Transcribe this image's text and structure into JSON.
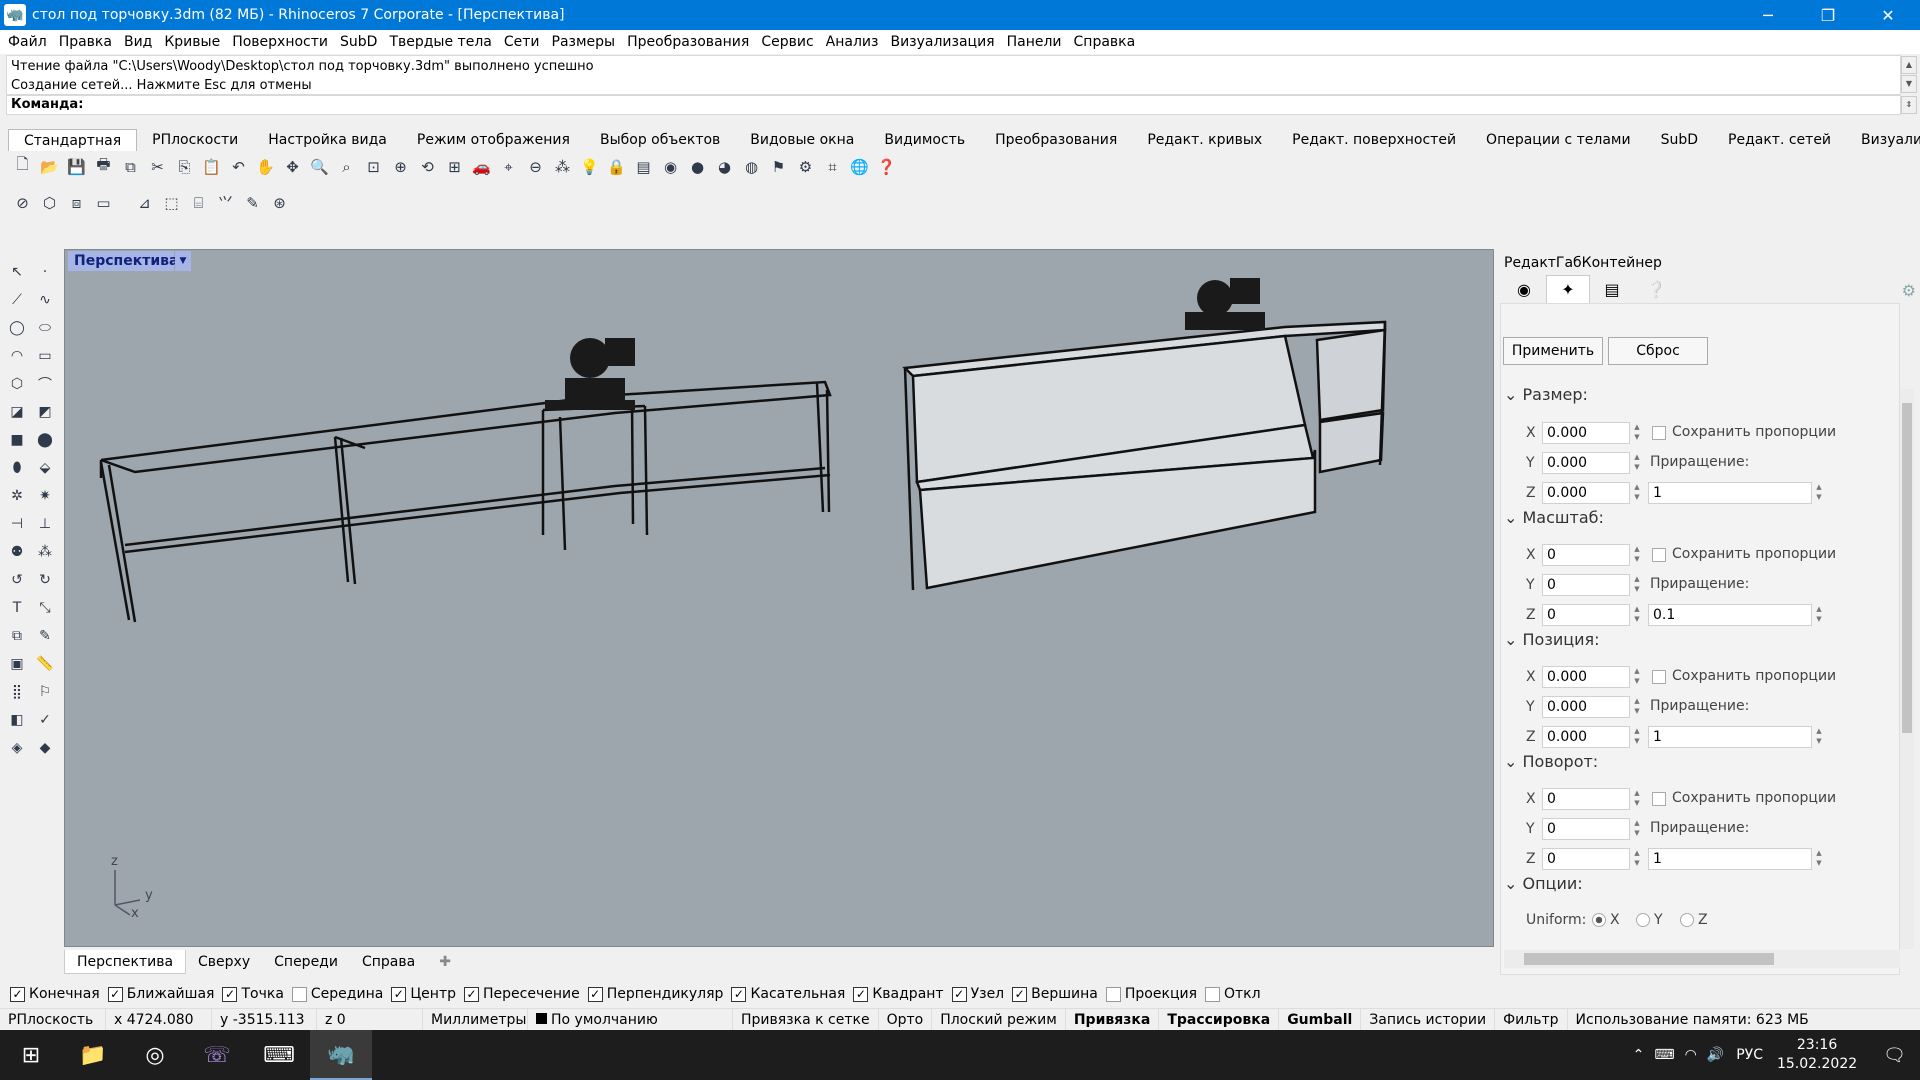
{
  "window": {
    "title": "стол под торчовку.3dm (82 МБ) - Rhinoceros 7 Corporate - [Перспектива]"
  },
  "menu": [
    "Файл",
    "Правка",
    "Вид",
    "Кривые",
    "Поверхности",
    "SubD",
    "Твердые тела",
    "Сети",
    "Размеры",
    "Преобразования",
    "Сервис",
    "Анализ",
    "Визуализация",
    "Панели",
    "Справка"
  ],
  "history": {
    "line1": "Чтение файла \"C:\\Users\\Woody\\Desktop\\стол под торчовку.3dm\" выполнено успешно",
    "line2": "Создание сетей... Нажмите Esc для отмены"
  },
  "command": {
    "label": "Команда:"
  },
  "tabs": [
    "Стандартная",
    "РПлоскости",
    "Настройка вида",
    "Режим отображения",
    "Выбор объектов",
    "Видовые окна",
    "Видимость",
    "Преобразования",
    "Редакт. кривых",
    "Редакт. поверхностей",
    "Операции с телами",
    "SubD",
    "Редакт. сетей",
    "Визуализация"
  ],
  "viewport": {
    "label": "Перспектива",
    "axis_z": "z",
    "axis_y": "y",
    "axis_x": "x"
  },
  "viewport_tabs": [
    "Перспектива",
    "Сверху",
    "Спереди",
    "Справа"
  ],
  "panel": {
    "title": "РедактГабКонтейнер",
    "apply": "Применить",
    "reset": "Сброс",
    "keep": "Сохранить пропорции",
    "increment": "Приращение:",
    "sections": [
      {
        "name": "Размер:",
        "x": "0.000",
        "y": "0.000",
        "z": "0.000",
        "inc": "1"
      },
      {
        "name": "Масштаб:",
        "x": "0",
        "y": "0",
        "z": "0",
        "inc": "0.1"
      },
      {
        "name": "Позиция:",
        "x": "0.000",
        "y": "0.000",
        "z": "0.000",
        "inc": "1"
      },
      {
        "name": "Поворот:",
        "x": "0",
        "y": "0",
        "z": "0",
        "inc": "1"
      }
    ],
    "options": "Опции:",
    "uniform": "Uniform:",
    "ux": "X",
    "uy": "Y",
    "uz": "Z",
    "X": "X",
    "Y": "Y",
    "Z": "Z"
  },
  "osnap": [
    {
      "label": "Конечная",
      "on": true
    },
    {
      "label": "Ближайшая",
      "on": true
    },
    {
      "label": "Точка",
      "on": true
    },
    {
      "label": "Середина",
      "on": false
    },
    {
      "label": "Центр",
      "on": true
    },
    {
      "label": "Пересечение",
      "on": true
    },
    {
      "label": "Перпендикуляр",
      "on": true
    },
    {
      "label": "Касательная",
      "on": true
    },
    {
      "label": "Квадрант",
      "on": true
    },
    {
      "label": "Узел",
      "on": true
    },
    {
      "label": "Вершина",
      "on": true
    },
    {
      "label": "Проекция",
      "on": false
    },
    {
      "label": "Откл",
      "on": false
    }
  ],
  "status": {
    "cplane": "РПлоскость",
    "x": "x 4724.080",
    "y": "y -3515.113",
    "z": "z 0",
    "units": "Миллиметры",
    "layer": "По умолчанию",
    "grid": "Привязка к сетке",
    "ortho": "Орто",
    "planar": "Плоский режим",
    "snap": "Привязка",
    "tracking": "Трассировка",
    "gumball": "Gumball",
    "history": "Запись истории",
    "filter": "Фильтр",
    "memory": "Использование памяти: 623 МБ"
  },
  "taskbar": {
    "lang": "РУС",
    "time": "23:16",
    "date": "15.02.2022"
  },
  "colors": {
    "accent": "#0078d7",
    "viewport_bg": "#9da5ad",
    "viewport_label_bg": "#a6b4e6"
  }
}
